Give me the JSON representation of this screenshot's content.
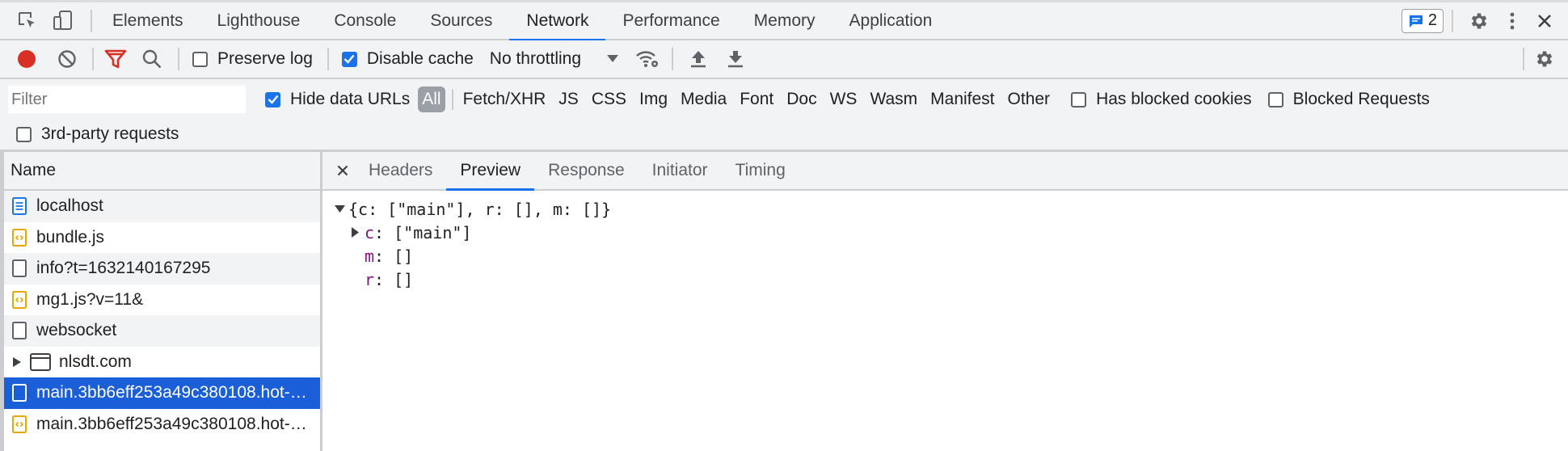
{
  "main_tabs": [
    {
      "label": "Elements"
    },
    {
      "label": "Lighthouse"
    },
    {
      "label": "Console"
    },
    {
      "label": "Sources"
    },
    {
      "label": "Network"
    },
    {
      "label": "Performance"
    },
    {
      "label": "Memory"
    },
    {
      "label": "Application"
    }
  ],
  "active_main_tab": "Network",
  "issues_count": "2",
  "toolbar": {
    "preserve_log": "Preserve log",
    "disable_cache": "Disable cache",
    "throttling": "No throttling"
  },
  "filter": {
    "placeholder": "Filter",
    "hide_data_urls": "Hide data URLs",
    "types": [
      "All",
      "Fetch/XHR",
      "JS",
      "CSS",
      "Img",
      "Media",
      "Font",
      "Doc",
      "WS",
      "Wasm",
      "Manifest",
      "Other"
    ],
    "has_blocked_cookies": "Has blocked cookies",
    "blocked_requests": "Blocked Requests",
    "third_party": "3rd-party requests"
  },
  "requests": {
    "header": "Name",
    "rows": [
      {
        "name": "localhost",
        "icon": "document-icon"
      },
      {
        "name": "bundle.js",
        "icon": "script-icon"
      },
      {
        "name": "info?t=1632140167295",
        "icon": "file-icon"
      },
      {
        "name": "mg1.js?v=11&",
        "icon": "script-icon"
      },
      {
        "name": "websocket",
        "icon": "file-icon"
      },
      {
        "name": "nlsdt.com",
        "icon": "frame-icon"
      },
      {
        "name": "main.3bb6eff253a49c380108.hot-update.json",
        "icon": "file-icon"
      },
      {
        "name": "main.3bb6eff253a49c380108.hot-update.js",
        "icon": "script-icon"
      }
    ]
  },
  "detail_tabs": [
    {
      "label": "Headers"
    },
    {
      "label": "Preview"
    },
    {
      "label": "Response"
    },
    {
      "label": "Initiator"
    },
    {
      "label": "Timing"
    }
  ],
  "preview": {
    "summary": "{c: [\"main\"], r: [], m: []}",
    "c_key": "c",
    "c_val": ": [\"main\"]",
    "m_key": "m",
    "m_val": ": []",
    "r_key": "r",
    "r_val": ": []"
  },
  "colors": {
    "accent": "#1a73e8",
    "record": "#d93025",
    "selected_row": "#1a5fd8"
  }
}
